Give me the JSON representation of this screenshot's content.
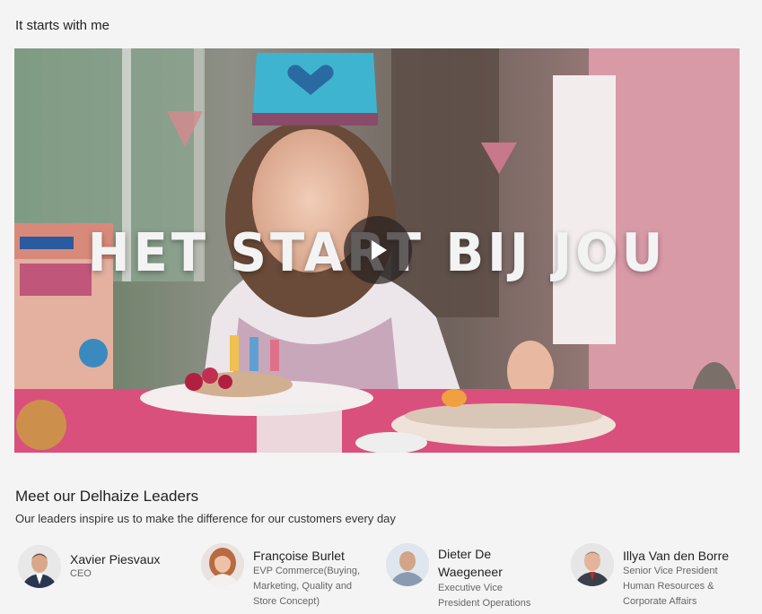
{
  "section": {
    "title": "It starts with me"
  },
  "video": {
    "overlay_text": "HET START BIJ JOU",
    "play_label": "Play video"
  },
  "leaders": {
    "title": "Meet our Delhaize Leaders",
    "subtitle": "Our leaders inspire us to make the difference for our customers every day",
    "people": [
      {
        "name": "Xavier Piesvaux",
        "role_lines": [
          "CEO"
        ]
      },
      {
        "name": "Françoise Burlet",
        "role_lines": [
          "EVP Commerce(Buying,",
          "Marketing, Quality and",
          "Store Concept)"
        ]
      },
      {
        "name_lines": [
          "Dieter De",
          "Waegeneer"
        ],
        "role_lines": [
          "Executive Vice",
          "President Operations"
        ]
      },
      {
        "name": "Illya Van den Borre",
        "role_lines": [
          "Senior Vice President",
          "Human Resources &",
          "Corporate Affairs"
        ]
      }
    ]
  },
  "colors": {
    "accent": "#e23a6a",
    "text": "#222222",
    "muted": "#666666"
  }
}
